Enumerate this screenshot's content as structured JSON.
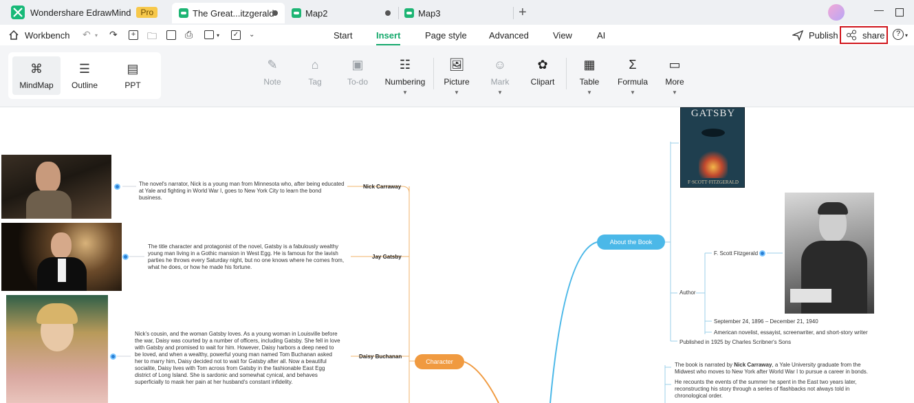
{
  "titlebar": {
    "app_name": "Wondershare EdrawMind",
    "pro_badge": "Pro",
    "tabs": [
      {
        "label": "The Great...itzgerald",
        "active": true
      },
      {
        "label": "Map2",
        "active": false
      },
      {
        "label": "Map3",
        "active": false
      }
    ],
    "new_tab_icon": "plus-icon"
  },
  "menubar": {
    "workbench": "Workbench",
    "items": [
      "Start",
      "Insert",
      "Page style",
      "Advanced",
      "View",
      "AI"
    ],
    "active": "Insert",
    "publish": "Publish",
    "share": "share",
    "help_icon": "question-icon"
  },
  "ribbon": {
    "views": [
      "MindMap",
      "Outline",
      "PPT"
    ],
    "selected_view": "MindMap",
    "buttons": [
      {
        "label": "Note",
        "icon": "pencil-icon",
        "disabled": true,
        "dropdown": false
      },
      {
        "label": "Tag",
        "icon": "tag-icon",
        "disabled": true,
        "dropdown": false
      },
      {
        "label": "To-do",
        "icon": "checklist-icon",
        "disabled": true,
        "dropdown": false
      },
      {
        "label": "Numbering",
        "icon": "numbered-list-icon",
        "disabled": false,
        "dropdown": true
      },
      {
        "label": "Picture",
        "icon": "image-icon",
        "disabled": false,
        "dropdown": true
      },
      {
        "label": "Mark",
        "icon": "smiley-icon",
        "disabled": true,
        "dropdown": true
      },
      {
        "label": "Clipart",
        "icon": "clipart-icon",
        "disabled": false,
        "dropdown": false
      },
      {
        "label": "Table",
        "icon": "table-icon",
        "disabled": false,
        "dropdown": true
      },
      {
        "label": "Formula",
        "icon": "sigma-icon",
        "disabled": false,
        "dropdown": true
      },
      {
        "label": "More",
        "icon": "more-icon",
        "disabled": false,
        "dropdown": true
      }
    ]
  },
  "mindmap": {
    "character_node": "Character",
    "about_node": "About the Book",
    "characters": [
      {
        "name": "Nick Carraway",
        "desc": "The novel's narrator, Nick is a young man from Minnesota who, after being educated at Yale and fighting in World War I, goes to New York City to learn the bond business."
      },
      {
        "name": "Jay Gatsby",
        "desc": "The title character and protagonist of the novel, Gatsby is a fabulously wealthy young man living in a Gothic mansion in West Egg. He is famous for the lavish parties he throws every Saturday night, but no one knows where he comes from, what he does, or how he made his fortune."
      },
      {
        "name": "Daisy Buchanan",
        "desc": "Nick's cousin, and the woman Gatsby loves. As a young woman in Louisville before the war, Daisy was courted by a number of officers, including Gatsby. She fell in love with Gatsby and promised to wait for him. However, Daisy harbors a deep need to be loved, and when a wealthy, powerful young man named Tom Buchanan asked her to marry him, Daisy decided not to wait for Gatsby after all. Now a beautiful socialite, Daisy lives with Tom across from Gatsby in the fashionable East Egg district of Long Island. She is sardonic and somewhat cynical, and behaves superficially to mask her pain at her husband's constant infidelity."
      }
    ],
    "book_cover_title": "GATSBY",
    "book_cover_author": "F·SCOTT·FITZGERALD",
    "author_label": "Author",
    "author_name": "F. Scott Fitzgerald",
    "author_dates": "September 24, 1896 – December 21, 1940",
    "author_desc": "American novelist, essayist, screenwriter, and short-story writer",
    "published": "Published in 1925 by Charles Scribner's Sons",
    "narration_pre": "The book is narrated by ",
    "narration_bold": "Nick Carraway",
    "narration_post": ", a Yale University graduate from the Midwest who moves to New York after World War I to pursue a career in bonds.",
    "recount": "He recounts the events of the summer he spent in the East two years later, reconstructing his story through a series of flashbacks not always told in chronological order."
  }
}
